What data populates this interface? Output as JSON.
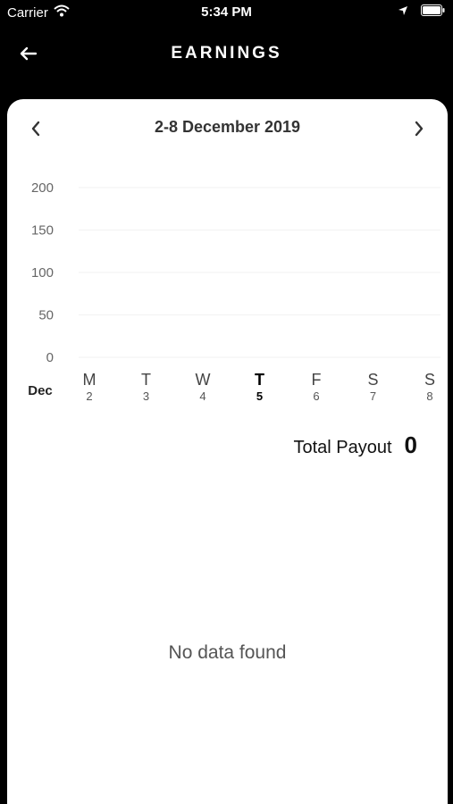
{
  "status_bar": {
    "carrier": "Carrier",
    "time": "5:34 PM"
  },
  "header": {
    "title": "EARNINGS"
  },
  "week_nav": {
    "range": "2-8 December 2019"
  },
  "chart_data": {
    "type": "bar",
    "month_label": "Dec",
    "categories": [
      "M",
      "T",
      "W",
      "T",
      "F",
      "S",
      "S"
    ],
    "dates": [
      "2",
      "3",
      "4",
      "5",
      "6",
      "7",
      "8"
    ],
    "highlighted_index": 3,
    "yticks": [
      0,
      50,
      100,
      150,
      200
    ],
    "ylim": [
      0,
      200
    ],
    "values": [
      0,
      0,
      0,
      0,
      0,
      0,
      0
    ],
    "grid": true
  },
  "summary": {
    "total_label": "Total Payout",
    "total_value": "0"
  },
  "empty_state": {
    "message": "No data found"
  }
}
